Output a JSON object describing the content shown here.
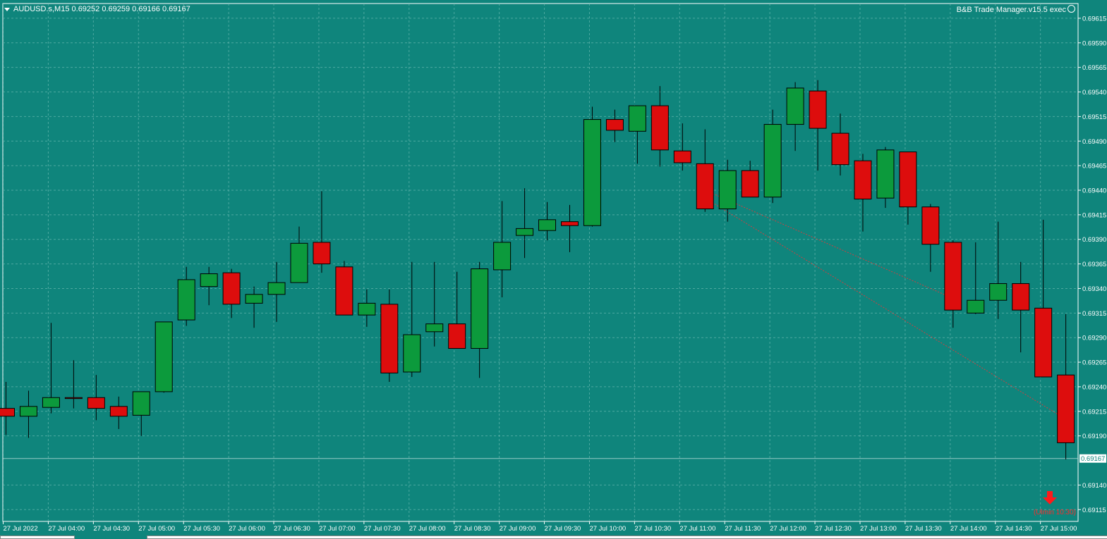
{
  "window": {
    "symbol_info": "AUDUSD.s,M15  0.69252 0.69259 0.69166 0.69167",
    "ea_label": "B&B Trade Manager.v15.5 exec",
    "timer_label": "(Ulmin 10:30)",
    "background_color": "#0f857c",
    "grid_color": "#6fbcb4",
    "bull_color": "#0c9a3c",
    "bear_color": "#dd0d0d",
    "axis_text_color": "#ffffff",
    "price_tag_bg": "#ffffff",
    "price_tag_color": "#0f857c",
    "trend_line_color": "#d04040",
    "arrow_icon": "down-arrow-icon"
  },
  "chart_data": {
    "type": "candlestick",
    "symbol": "AUDUSD.s",
    "timeframe": "M15",
    "ylim": [
      0.69103,
      0.6963
    ],
    "y_ticks": [
      "0.69615",
      "0.69590",
      "0.69565",
      "0.69540",
      "0.69515",
      "0.69490",
      "0.69465",
      "0.69440",
      "0.69415",
      "0.69390",
      "0.69365",
      "0.69340",
      "0.69315",
      "0.69290",
      "0.69265",
      "0.69240",
      "0.69215",
      "0.69190",
      "0.69140",
      "0.69115"
    ],
    "current_price": "0.69167",
    "x_labels": [
      "27 Jul 2022",
      "27 Jul 04:00",
      "27 Jul 04:30",
      "27 Jul 05:00",
      "27 Jul 05:30",
      "27 Jul 06:00",
      "27 Jul 06:30",
      "27 Jul 07:00",
      "27 Jul 07:30",
      "27 Jul 08:00",
      "27 Jul 08:30",
      "27 Jul 09:00",
      "27 Jul 09:30",
      "27 Jul 10:00",
      "27 Jul 10:30",
      "27 Jul 11:00",
      "27 Jul 11:30",
      "27 Jul 12:00",
      "27 Jul 12:30",
      "27 Jul 13:00",
      "27 Jul 13:30",
      "27 Jul 14:00",
      "27 Jul 14:30",
      "27 Jul 15:00"
    ],
    "candles": [
      {
        "o": 0.69218,
        "h": 0.69245,
        "l": 0.69191,
        "c": 0.6921
      },
      {
        "o": 0.6921,
        "h": 0.69236,
        "l": 0.69188,
        "c": 0.6922
      },
      {
        "o": 0.69219,
        "h": 0.69305,
        "l": 0.69213,
        "c": 0.69229
      },
      {
        "o": 0.69229,
        "h": 0.69267,
        "l": 0.69218,
        "c": 0.69228
      },
      {
        "o": 0.69229,
        "h": 0.69252,
        "l": 0.69206,
        "c": 0.69218
      },
      {
        "o": 0.6922,
        "h": 0.6923,
        "l": 0.69197,
        "c": 0.6921
      },
      {
        "o": 0.69211,
        "h": 0.69235,
        "l": 0.6919,
        "c": 0.69235
      },
      {
        "o": 0.69235,
        "h": 0.69306,
        "l": 0.69234,
        "c": 0.69306
      },
      {
        "o": 0.69308,
        "h": 0.69362,
        "l": 0.69302,
        "c": 0.69349
      },
      {
        "o": 0.69342,
        "h": 0.69362,
        "l": 0.69323,
        "c": 0.69355
      },
      {
        "o": 0.69356,
        "h": 0.6936,
        "l": 0.6931,
        "c": 0.69324
      },
      {
        "o": 0.69325,
        "h": 0.69342,
        "l": 0.693,
        "c": 0.69334
      },
      {
        "o": 0.69334,
        "h": 0.69367,
        "l": 0.69306,
        "c": 0.69346
      },
      {
        "o": 0.69346,
        "h": 0.69403,
        "l": 0.69346,
        "c": 0.69386
      },
      {
        "o": 0.69387,
        "h": 0.69439,
        "l": 0.69356,
        "c": 0.69365
      },
      {
        "o": 0.69362,
        "h": 0.69368,
        "l": 0.69313,
        "c": 0.69313
      },
      {
        "o": 0.69313,
        "h": 0.69339,
        "l": 0.69301,
        "c": 0.69325
      },
      {
        "o": 0.69324,
        "h": 0.69339,
        "l": 0.69245,
        "c": 0.69254
      },
      {
        "o": 0.69255,
        "h": 0.69367,
        "l": 0.6925,
        "c": 0.69293
      },
      {
        "o": 0.69296,
        "h": 0.69367,
        "l": 0.69281,
        "c": 0.69304
      },
      {
        "o": 0.69304,
        "h": 0.69357,
        "l": 0.69279,
        "c": 0.69279
      },
      {
        "o": 0.69279,
        "h": 0.69367,
        "l": 0.69249,
        "c": 0.6936
      },
      {
        "o": 0.69359,
        "h": 0.69429,
        "l": 0.69331,
        "c": 0.69387
      },
      {
        "o": 0.69394,
        "h": 0.69442,
        "l": 0.69371,
        "c": 0.69401
      },
      {
        "o": 0.69399,
        "h": 0.69428,
        "l": 0.69389,
        "c": 0.6941
      },
      {
        "o": 0.69408,
        "h": 0.69425,
        "l": 0.69377,
        "c": 0.69404
      },
      {
        "o": 0.69404,
        "h": 0.69525,
        "l": 0.69403,
        "c": 0.69512
      },
      {
        "o": 0.69512,
        "h": 0.69522,
        "l": 0.69489,
        "c": 0.69501
      },
      {
        "o": 0.695,
        "h": 0.69523,
        "l": 0.69467,
        "c": 0.69526
      },
      {
        "o": 0.69526,
        "h": 0.69546,
        "l": 0.69464,
        "c": 0.69481
      },
      {
        "o": 0.6948,
        "h": 0.69508,
        "l": 0.6946,
        "c": 0.69468
      },
      {
        "o": 0.69467,
        "h": 0.69502,
        "l": 0.69418,
        "c": 0.69421
      },
      {
        "o": 0.69421,
        "h": 0.69471,
        "l": 0.69408,
        "c": 0.6946
      },
      {
        "o": 0.6946,
        "h": 0.6947,
        "l": 0.69433,
        "c": 0.69433
      },
      {
        "o": 0.69433,
        "h": 0.69522,
        "l": 0.69427,
        "c": 0.69507
      },
      {
        "o": 0.69507,
        "h": 0.6955,
        "l": 0.6948,
        "c": 0.69544
      },
      {
        "o": 0.69541,
        "h": 0.69552,
        "l": 0.6946,
        "c": 0.69503
      },
      {
        "o": 0.69498,
        "h": 0.69518,
        "l": 0.69455,
        "c": 0.69466
      },
      {
        "o": 0.6947,
        "h": 0.69477,
        "l": 0.69398,
        "c": 0.69431
      },
      {
        "o": 0.69432,
        "h": 0.69484,
        "l": 0.69422,
        "c": 0.69481
      },
      {
        "o": 0.69479,
        "h": 0.69478,
        "l": 0.69405,
        "c": 0.69423
      },
      {
        "o": 0.69423,
        "h": 0.69426,
        "l": 0.69357,
        "c": 0.69385
      },
      {
        "o": 0.69387,
        "h": 0.69389,
        "l": 0.693,
        "c": 0.69318
      },
      {
        "o": 0.69315,
        "h": 0.69387,
        "l": 0.69314,
        "c": 0.69328
      },
      {
        "o": 0.69328,
        "h": 0.69408,
        "l": 0.69309,
        "c": 0.69345
      },
      {
        "o": 0.69345,
        "h": 0.69367,
        "l": 0.69275,
        "c": 0.69318
      },
      {
        "o": 0.6932,
        "h": 0.6941,
        "l": 0.6925,
        "c": 0.6925
      },
      {
        "o": 0.69252,
        "h": 0.69314,
        "l": 0.69166,
        "c": 0.69183
      }
    ],
    "trend_lines": [
      {
        "from": [
          31,
          0.69432
        ],
        "to": [
          47,
          0.69207
        ]
      },
      {
        "from": [
          31,
          0.6944
        ],
        "to": [
          42,
          0.6933
        ]
      }
    ],
    "grid": true
  }
}
